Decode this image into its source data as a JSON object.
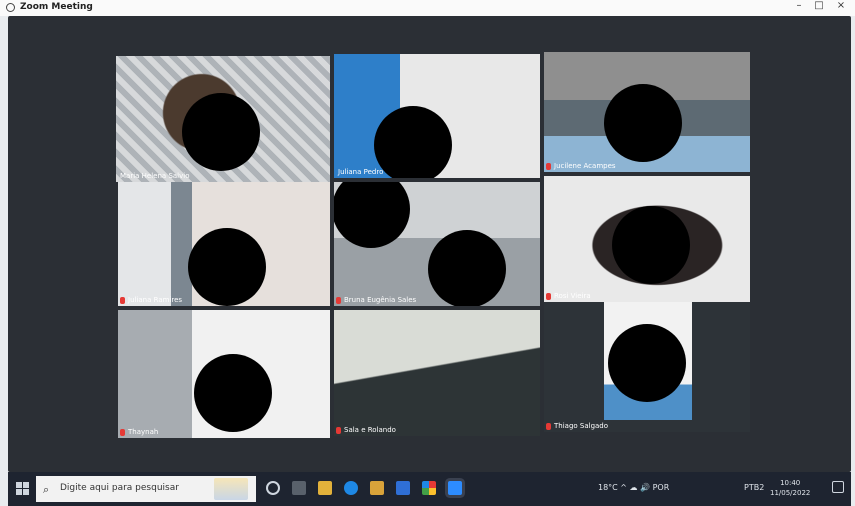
{
  "window": {
    "title": "Zoom Meeting",
    "controls": [
      "–",
      "□",
      "×"
    ]
  },
  "participants": [
    {
      "name": "Maria Helena Salvio",
      "muted": false,
      "highlighted": true
    },
    {
      "name": "Juliana Pedro",
      "muted": false,
      "highlighted": false
    },
    {
      "name": "Jucilene Acampes",
      "muted": true,
      "highlighted": false
    },
    {
      "name": "Juliana Ramires",
      "muted": true,
      "highlighted": false
    },
    {
      "name": "Bruna Eugênia Sales",
      "muted": true,
      "highlighted": false
    },
    {
      "name": "Rosi Vieira",
      "muted": true,
      "highlighted": false
    },
    {
      "name": "Thaynah",
      "muted": true,
      "highlighted": false
    },
    {
      "name": "Sala e Rolando",
      "muted": true,
      "highlighted": false
    },
    {
      "name": "Thiago Salgado",
      "muted": true,
      "highlighted": false
    }
  ],
  "taskbar": {
    "search_placeholder": "Digite aqui para pesquisar",
    "tray_text": "18°C  ^  ☁  🔊  POR",
    "clock_time": "10:40",
    "clock_date": "11/05/2022",
    "lang": "PTB2"
  },
  "colors": {
    "highlight": "#f1e14a",
    "muted_mic": "#e53935",
    "taskbar": "#1e2430"
  }
}
